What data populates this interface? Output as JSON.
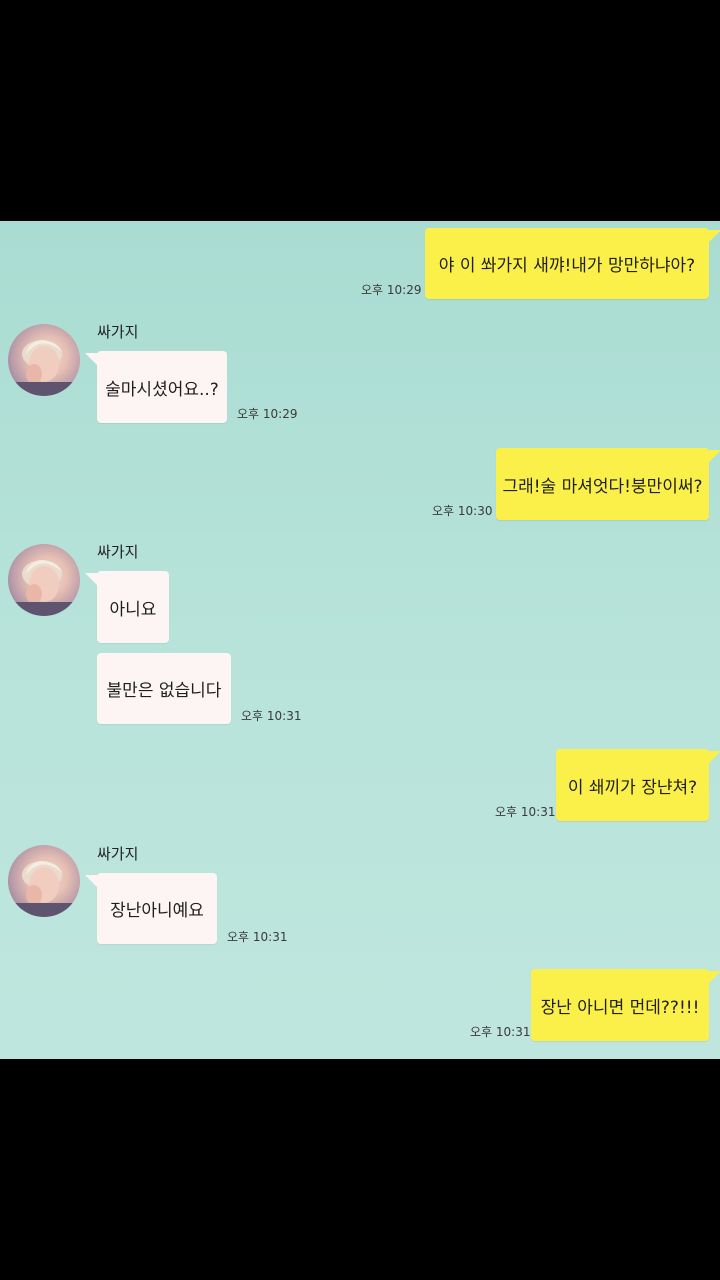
{
  "contact": {
    "name": "싸가지"
  },
  "messages": [
    {
      "from": "me",
      "text": "야 이 쏴가지 새꺄!내가 망만하냐아?",
      "time": "오후 10:29"
    },
    {
      "from": "them",
      "text": "술마시셨어요..?",
      "time": "오후 10:29"
    },
    {
      "from": "me",
      "text": "그래!술 마셔엇다!붕만이써?",
      "time": "오후 10:30"
    },
    {
      "from": "them",
      "text": "아니요",
      "time": ""
    },
    {
      "from": "them",
      "text": "불만은 없습니다",
      "time": "오후 10:31"
    },
    {
      "from": "me",
      "text": "이 쇄끼가 장냔쳐?",
      "time": "오후 10:31"
    },
    {
      "from": "them",
      "text": "장난아니예요",
      "time": "오후 10:31"
    },
    {
      "from": "me",
      "text": "장난 아니면 먼데??!!!",
      "time": "오후 10:31"
    }
  ],
  "colors": {
    "background": "#b7e3da",
    "my_bubble": "#fbf04a",
    "their_bubble": "#fdf5f3",
    "letterbox": "#000000"
  },
  "icons": {
    "avatar": "profile-photo"
  }
}
